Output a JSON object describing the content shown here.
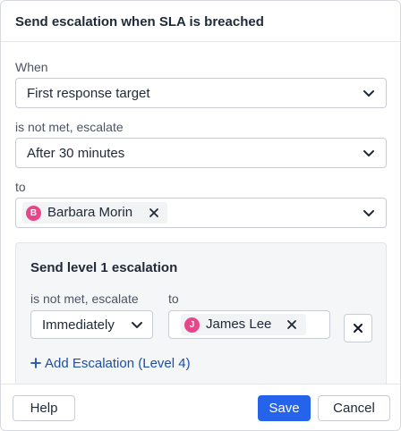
{
  "dialog": {
    "title": "Send escalation when SLA is breached"
  },
  "when": {
    "label": "When",
    "value": "First response target"
  },
  "condition": {
    "label": "is not met, escalate",
    "value": "After 30 minutes"
  },
  "to": {
    "label": "to",
    "assignee": {
      "initial": "B",
      "name": "Barbara Morin"
    }
  },
  "level_panel": {
    "title": "Send level 1 escalation",
    "condition_label": "is not met, escalate",
    "condition_value": "Immediately",
    "to_label": "to",
    "assignee": {
      "initial": "J",
      "name": "James Lee"
    },
    "add_link": "Add Escalation (Level 4)"
  },
  "footer": {
    "help_label": "Help",
    "save_label": "Save",
    "cancel_label": "Cancel"
  },
  "colors": {
    "primary": "#2563eb",
    "link": "#1d4ea8",
    "avatar": "#e6478a"
  },
  "icons": [
    "chevron-down-icon",
    "close-icon",
    "plus-icon"
  ]
}
